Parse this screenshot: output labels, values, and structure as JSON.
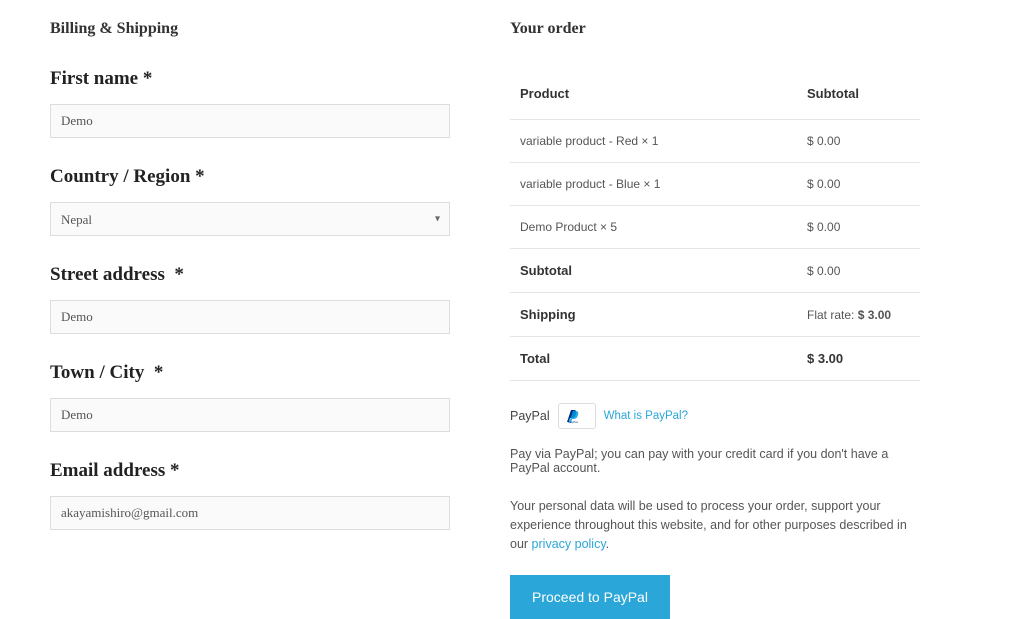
{
  "billing": {
    "section_title": "Billing & Shipping",
    "first_name_label": "First name",
    "first_name_value": "Demo",
    "country_label": "Country / Region",
    "country_value": "Nepal",
    "street_label": "Street address",
    "street_value": "Demo",
    "city_label": "Town / City",
    "city_value": "Demo",
    "email_label": "Email address",
    "email_value": "akayamishiro@gmail.com",
    "required_mark": "*"
  },
  "order": {
    "section_title": "Your order",
    "header_product": "Product",
    "header_subtotal": "Subtotal",
    "items": [
      {
        "name": "variable product - Red  × 1",
        "subtotal": "$ 0.00"
      },
      {
        "name": "variable product - Blue  × 1",
        "subtotal": "$ 0.00"
      },
      {
        "name": "Demo Product  × 5",
        "subtotal": "$ 0.00"
      }
    ],
    "subtotal_label": "Subtotal",
    "subtotal_value": "$ 0.00",
    "shipping_label": "Shipping",
    "shipping_value_prefix": "Flat rate: ",
    "shipping_value_amount": "$ 3.00",
    "total_label": "Total",
    "total_value": "$ 3.00"
  },
  "payment": {
    "method_label": "PayPal",
    "what_is_link": "What is PayPal?",
    "description": "Pay via PayPal; you can pay with your credit card if you don't have a PayPal account.",
    "privacy_text_1": "Your personal data will be used to process your order, support your experience throughout this website, and for other purposes described in our ",
    "privacy_link_text": "privacy policy",
    "privacy_text_2": ".",
    "proceed_label": "Proceed to PayPal"
  }
}
